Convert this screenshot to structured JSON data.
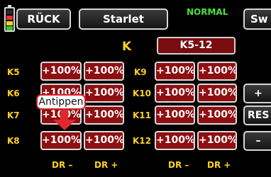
{
  "top_bar": {
    "back_label": "RÜCK",
    "model_name": "Starlet",
    "flight_mode": "NORMAL",
    "next_label": "Sw"
  },
  "table": {
    "left_header": "K",
    "right_header": "K5-12",
    "rows": [
      {
        "left_channel": "K5",
        "left_dr_minus": "+100%",
        "left_dr_plus": "+100%",
        "right_channel": "K9",
        "right_dr_minus": "+100%",
        "right_dr_plus": "+100%"
      },
      {
        "left_channel": "K6",
        "left_dr_minus": "+100%",
        "left_dr_plus": "+100%",
        "right_channel": "K10",
        "right_dr_minus": "+100%",
        "right_dr_plus": "+100%"
      },
      {
        "left_channel": "K7",
        "left_dr_minus": "+100%",
        "left_dr_plus": "+100%",
        "right_channel": "K11",
        "right_dr_minus": "+100%",
        "right_dr_plus": "+100%"
      },
      {
        "left_channel": "K8",
        "left_dr_minus": "+100%",
        "left_dr_plus": "+100%",
        "right_channel": "K12",
        "right_dr_minus": "+100%",
        "right_dr_plus": "+100%"
      }
    ],
    "footer": [
      "DR –",
      "DR +",
      "DR –",
      "DR +"
    ]
  },
  "side_buttons": {
    "plus": "+",
    "reset": "RES",
    "minus": "–"
  },
  "tooltip": {
    "text": "Antippen"
  },
  "icons": {
    "battery": "battery-icon",
    "pointer": "down-arrow-icon"
  },
  "colors": {
    "accent_yellow": "#ffd21e",
    "value_red": "#8e0f12",
    "mode_green": "#4ee03a",
    "pointer_red": "#e3262e"
  }
}
